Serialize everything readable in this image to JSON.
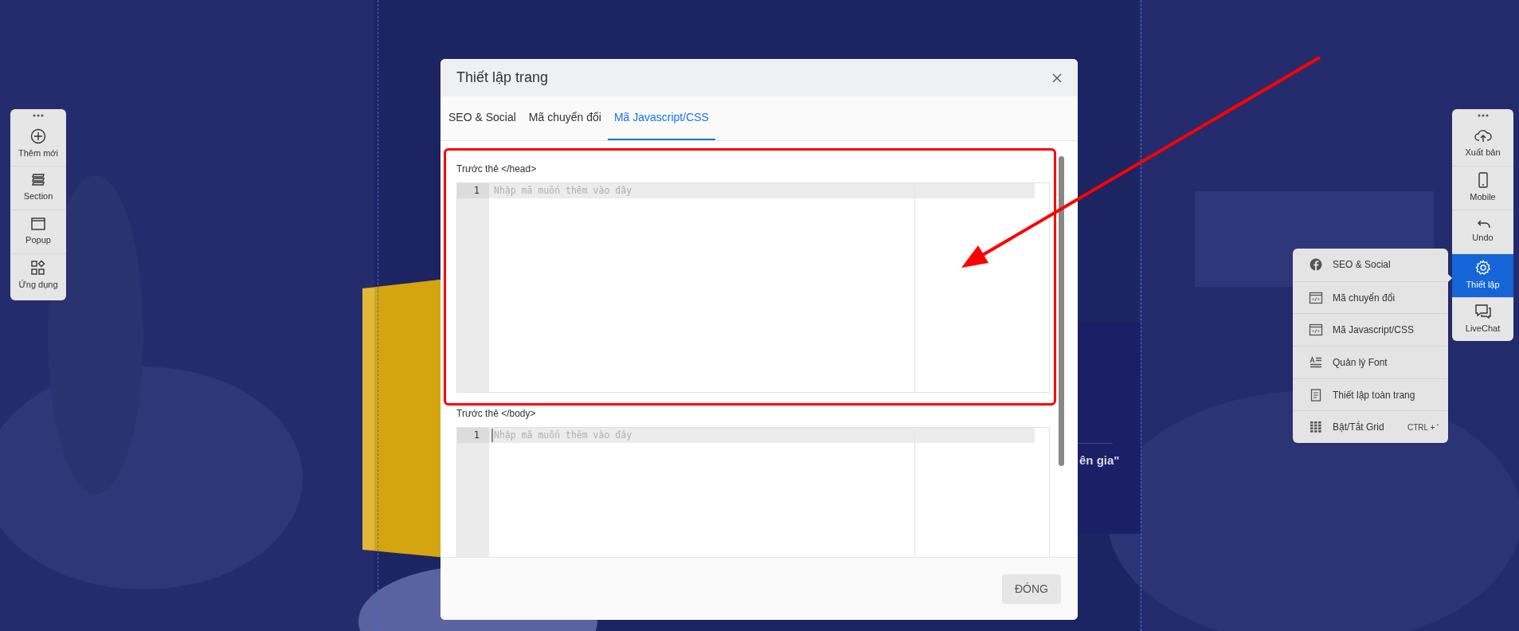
{
  "left_toolbar": {
    "items": [
      {
        "label": "Thêm mới"
      },
      {
        "label": "Section"
      },
      {
        "label": "Popup"
      },
      {
        "label": "Ứng dụng"
      }
    ]
  },
  "right_toolbar": {
    "items": [
      {
        "label": "Xuất bản",
        "selected": false
      },
      {
        "label": "Mobile",
        "selected": false
      },
      {
        "label": "Undo",
        "selected": false
      },
      {
        "label": "Thiết lập",
        "selected": true
      },
      {
        "label": "LiveChat",
        "selected": false
      }
    ]
  },
  "settings_menu": {
    "items": [
      {
        "label": "SEO & Social"
      },
      {
        "label": "Mã chuyển đổi"
      },
      {
        "label": "Mã Javascript/CSS"
      },
      {
        "label": "Quản lý Font"
      },
      {
        "label": "Thiết lập toàn trang"
      },
      {
        "label": "Bật/Tắt Grid",
        "shortcut": "CTRL + '"
      }
    ]
  },
  "page_text": "ên gia\"",
  "dialog": {
    "title": "Thiết lập trang",
    "tabs": [
      {
        "label": "SEO & Social",
        "selected": false
      },
      {
        "label": "Mã chuyển đổi",
        "selected": false
      },
      {
        "label": "Mã Javascript/CSS",
        "selected": true
      }
    ],
    "editors": [
      {
        "label": "Trước thẻ </head>",
        "line_number": "1",
        "placeholder": "Nhập mã muốn thêm vào đây",
        "focused": false
      },
      {
        "label": "Trước thẻ </body>",
        "line_number": "1",
        "placeholder": "Nhập mã muốn thêm vào đây",
        "focused": true
      }
    ],
    "close_button": "ĐÓNG"
  }
}
